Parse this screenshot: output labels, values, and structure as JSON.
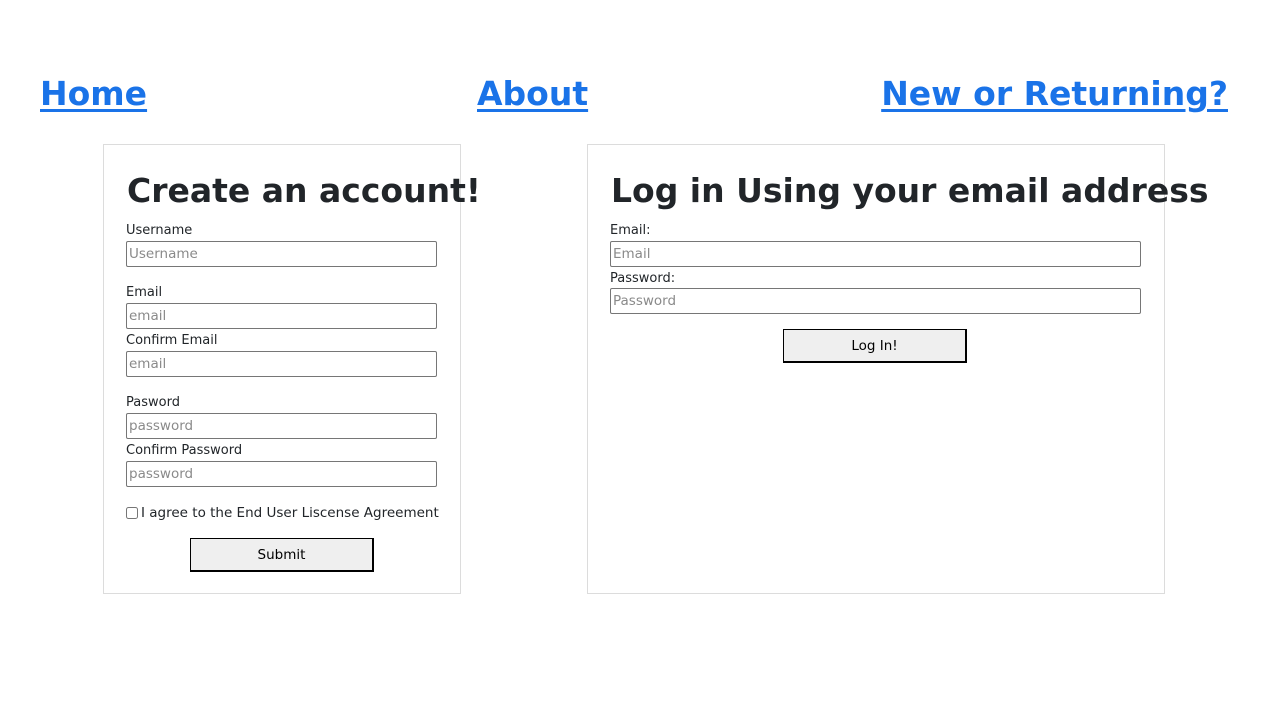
{
  "nav": {
    "home": "Home",
    "about": "About",
    "new_or_returning": "New or Returning?"
  },
  "signup": {
    "title": "Create an account!",
    "username_label": "Username",
    "username_placeholder": "Username",
    "email_label": "Email",
    "email_placeholder": "email",
    "confirm_email_label": "Confirm Email",
    "confirm_email_placeholder": "email",
    "password_label": "Pasword",
    "password_placeholder": "password",
    "confirm_password_label": "Confirm Password",
    "confirm_password_placeholder": "password",
    "agree_label": "I agree to the End User Liscense Agreement",
    "submit_label": "Submit"
  },
  "login": {
    "title": "Log in Using your email address",
    "email_label": "Email:",
    "email_placeholder": "Email",
    "password_label": "Password:",
    "password_placeholder": "Password",
    "login_label": "Log In!"
  },
  "colors": {
    "link": "#1a73e8",
    "text": "#212529",
    "card_border": "#dcdcdc"
  }
}
